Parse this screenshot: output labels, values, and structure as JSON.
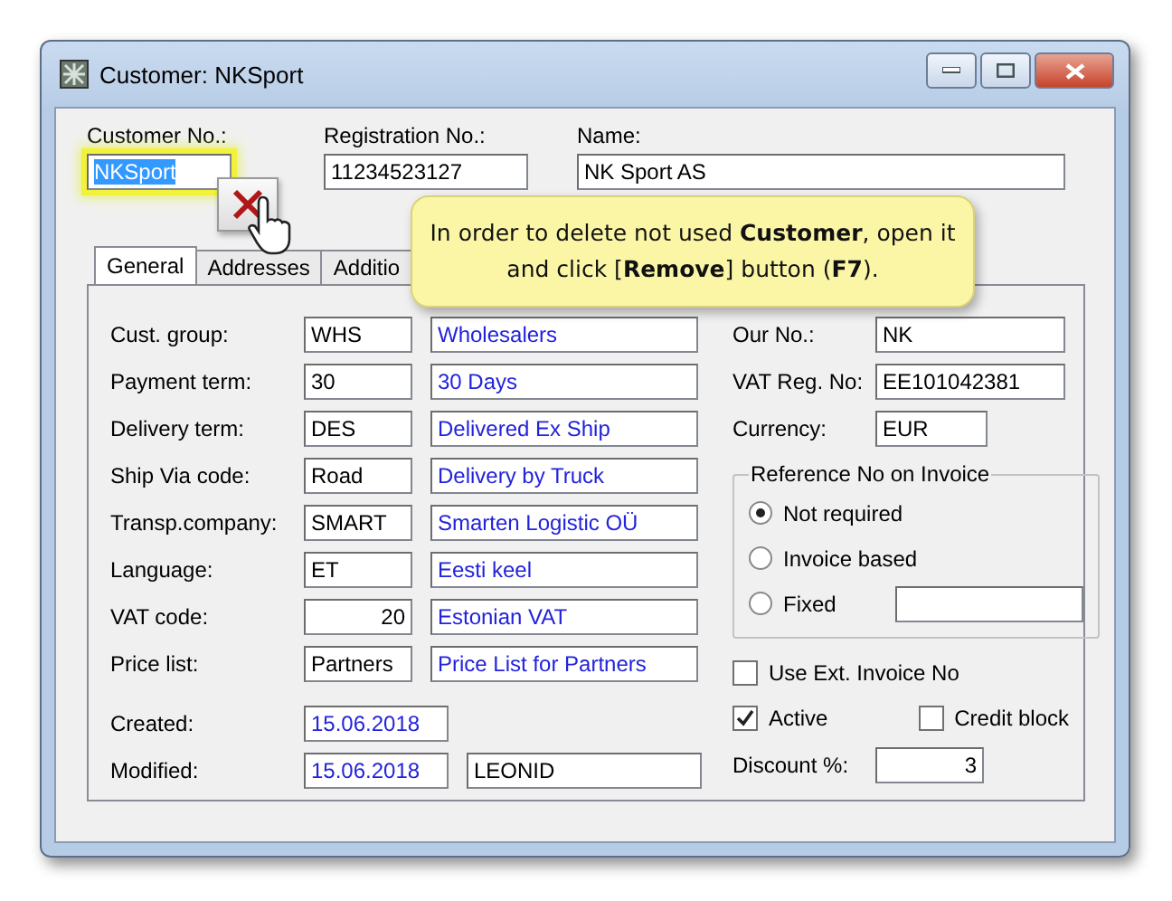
{
  "window": {
    "title": "Customer: NKSport"
  },
  "header_fields": [
    {
      "label": "Customer No.:",
      "value": "NKSport",
      "focused": true
    },
    {
      "label": "Registration No.:",
      "value": "11234523127",
      "focused": false
    },
    {
      "label": "Name:",
      "value": "NK Sport AS",
      "focused": false
    }
  ],
  "tabs": [
    {
      "label": "General",
      "selected": true
    },
    {
      "label": "Addresses",
      "selected": false
    },
    {
      "label": "Additio",
      "selected": false
    }
  ],
  "left_fields": [
    {
      "label": "Cust. group:",
      "code": "WHS",
      "description": "Wholesalers",
      "numeric": false
    },
    {
      "label": "Payment term:",
      "code": "30",
      "description": "30 Days",
      "numeric": false
    },
    {
      "label": "Delivery term:",
      "code": "DES",
      "description": "Delivered Ex Ship",
      "numeric": false
    },
    {
      "label": "Ship Via code:",
      "code": "Road",
      "description": "Delivery by Truck",
      "numeric": false
    },
    {
      "label": "Transp.company:",
      "code": "SMART",
      "description": "Smarten Logistic OÜ",
      "numeric": false
    },
    {
      "label": "Language:",
      "code": "ET",
      "description": "Eesti keel",
      "numeric": false
    },
    {
      "label": "VAT code:",
      "code": "20",
      "description": "Estonian VAT",
      "numeric": true
    },
    {
      "label": "Price list:",
      "code": "Partners",
      "description": "Price List for Partners",
      "numeric": false
    }
  ],
  "created": {
    "label": "Created:",
    "date": "15.06.2018"
  },
  "modified": {
    "label": "Modified:",
    "date": "15.06.2018",
    "user": "LEONID"
  },
  "right_fields": [
    {
      "label": "Our No.:",
      "value": "NK"
    },
    {
      "label": "VAT Reg. No:",
      "value": "EE101042381"
    },
    {
      "label": "Currency:",
      "value": "EUR"
    }
  ],
  "reference_group": {
    "title": "Reference No on Invoice",
    "options": [
      {
        "label": "Not required",
        "selected": true,
        "kind": "plain"
      },
      {
        "label": "Invoice based",
        "selected": false,
        "kind": "plain"
      },
      {
        "label": "Fixed",
        "selected": false,
        "kind": "with_field"
      }
    ]
  },
  "use_ext_invoice": {
    "label": "Use Ext. Invoice No",
    "checked": false
  },
  "active": {
    "label": "Active",
    "checked": true
  },
  "credit_block": {
    "label": "Credit block",
    "checked": false
  },
  "discount": {
    "label": "Discount %:",
    "value": "3"
  },
  "callout": {
    "text": "In order to delete not used **Customer**, open it and click [**Remove**] button (**F7**)."
  }
}
